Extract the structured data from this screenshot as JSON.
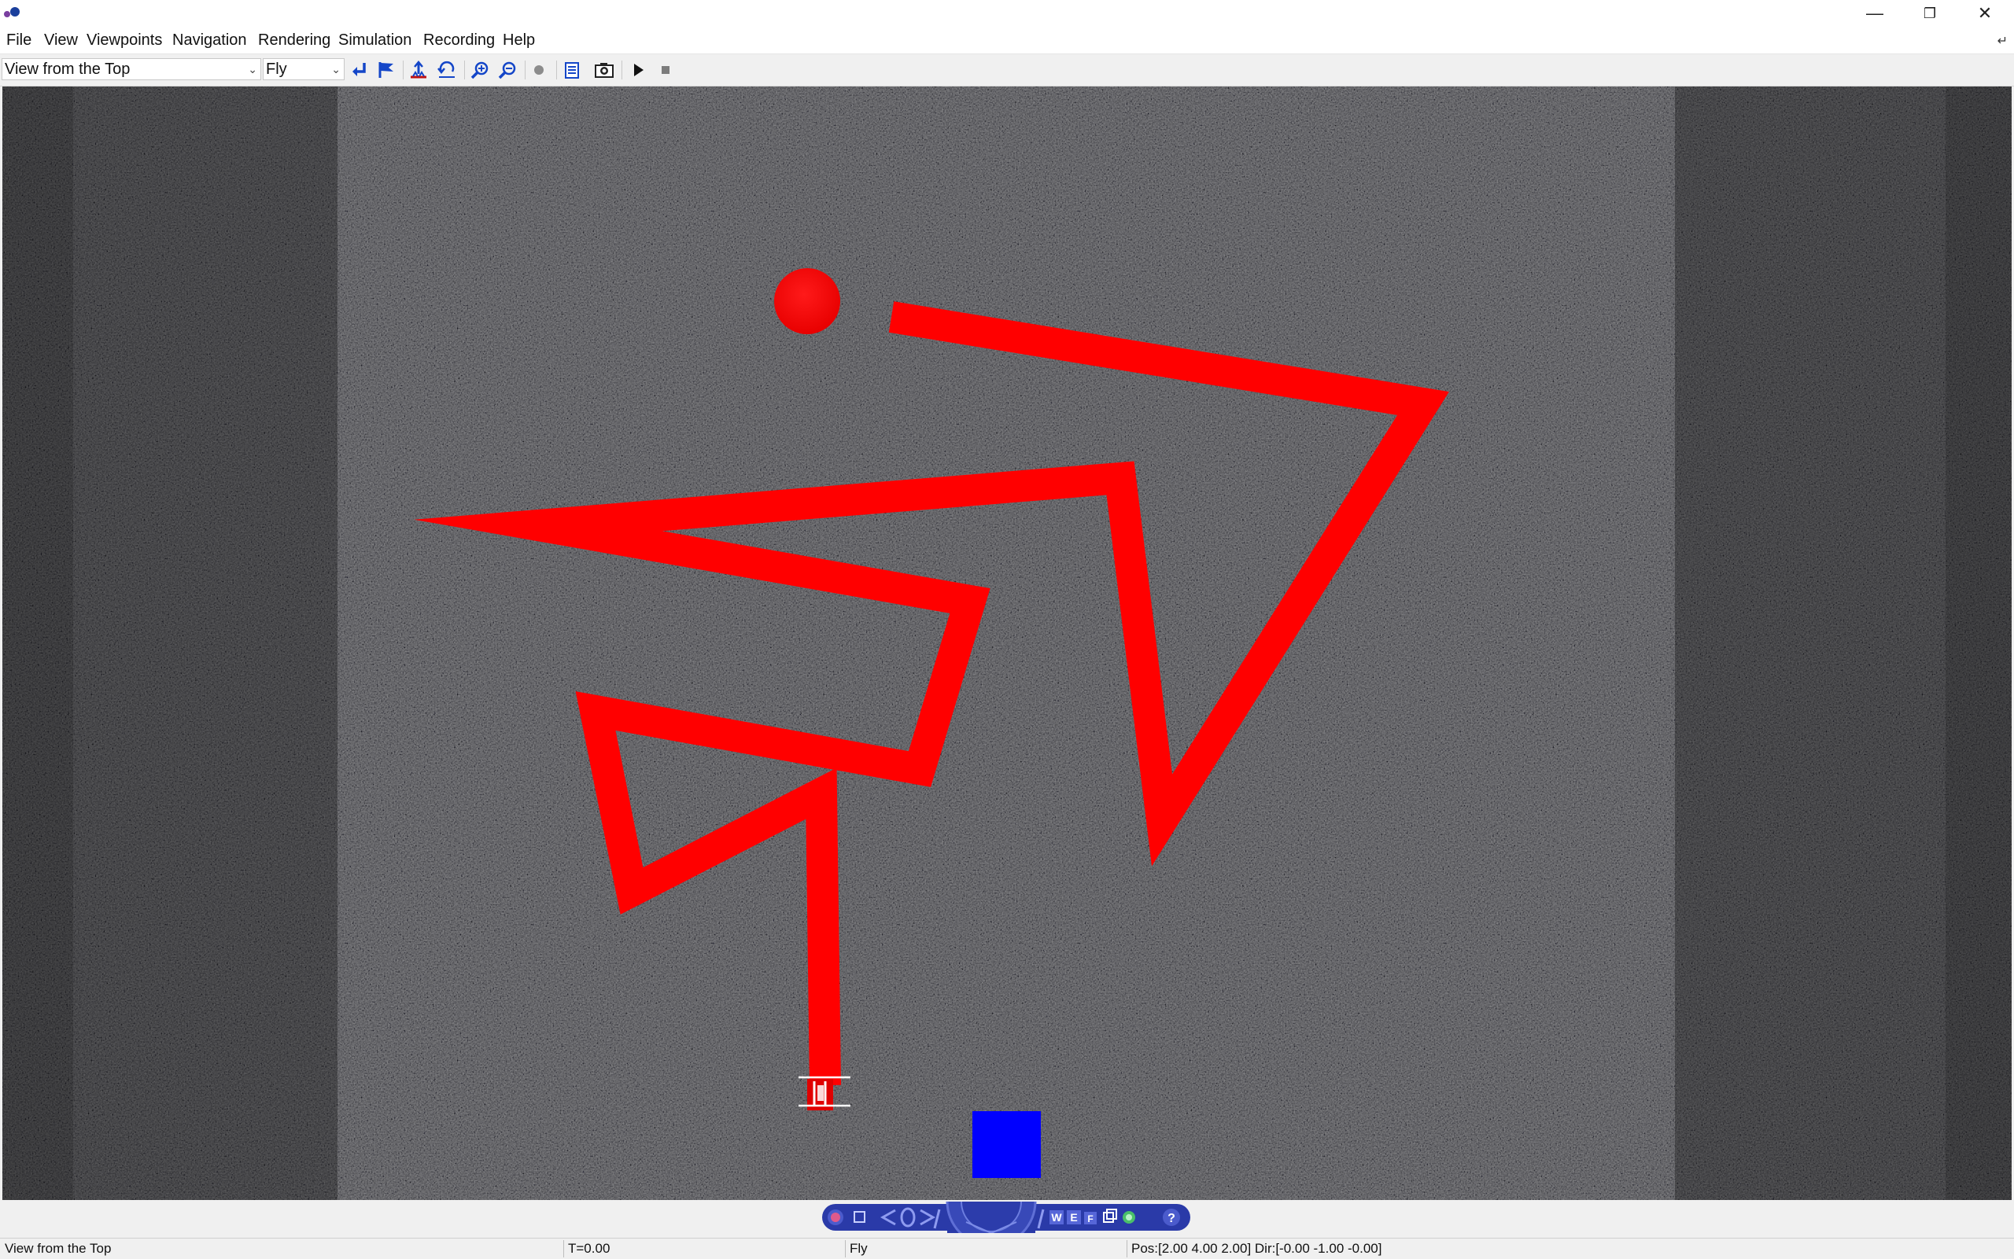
{
  "window": {
    "controls": [
      "minimize",
      "maximize",
      "close"
    ]
  },
  "menu": {
    "items": [
      "File",
      "View",
      "Viewpoints",
      "Navigation",
      "Rendering",
      "Simulation",
      "Recording",
      "Help"
    ]
  },
  "toolbar": {
    "viewpoint_select": "View from the Top",
    "navigation_select": "Fly",
    "buttons": [
      "previous-viewpoint",
      "add-viewpoint",
      "straighten",
      "return-to-viewpoint",
      "zoom-in",
      "zoom-out",
      "record",
      "console",
      "screenshot",
      "play",
      "stop"
    ]
  },
  "scene": {
    "floor_color": "#3b3b3d",
    "path_color": "#ff0000",
    "box_color": "#0000ff",
    "objects": [
      "red-ball",
      "red-path",
      "robot",
      "blue-box"
    ]
  },
  "nav_panel": {
    "buttons": [
      "close",
      "restore",
      "left-arrow",
      "orbit",
      "right-arrow",
      "compass-wheel",
      "walk",
      "examine",
      "fly",
      "viewpoints",
      "lighting",
      "help"
    ],
    "labels": {
      "walk": "W",
      "examine": "E",
      "fly": "F",
      "help": "?"
    }
  },
  "status": {
    "viewpoint": "View from the Top",
    "time": "T=0.00",
    "mode": "Fly",
    "position": "Pos:[2.00 4.00 2.00] Dir:[-0.00 -1.00 -0.00]"
  }
}
